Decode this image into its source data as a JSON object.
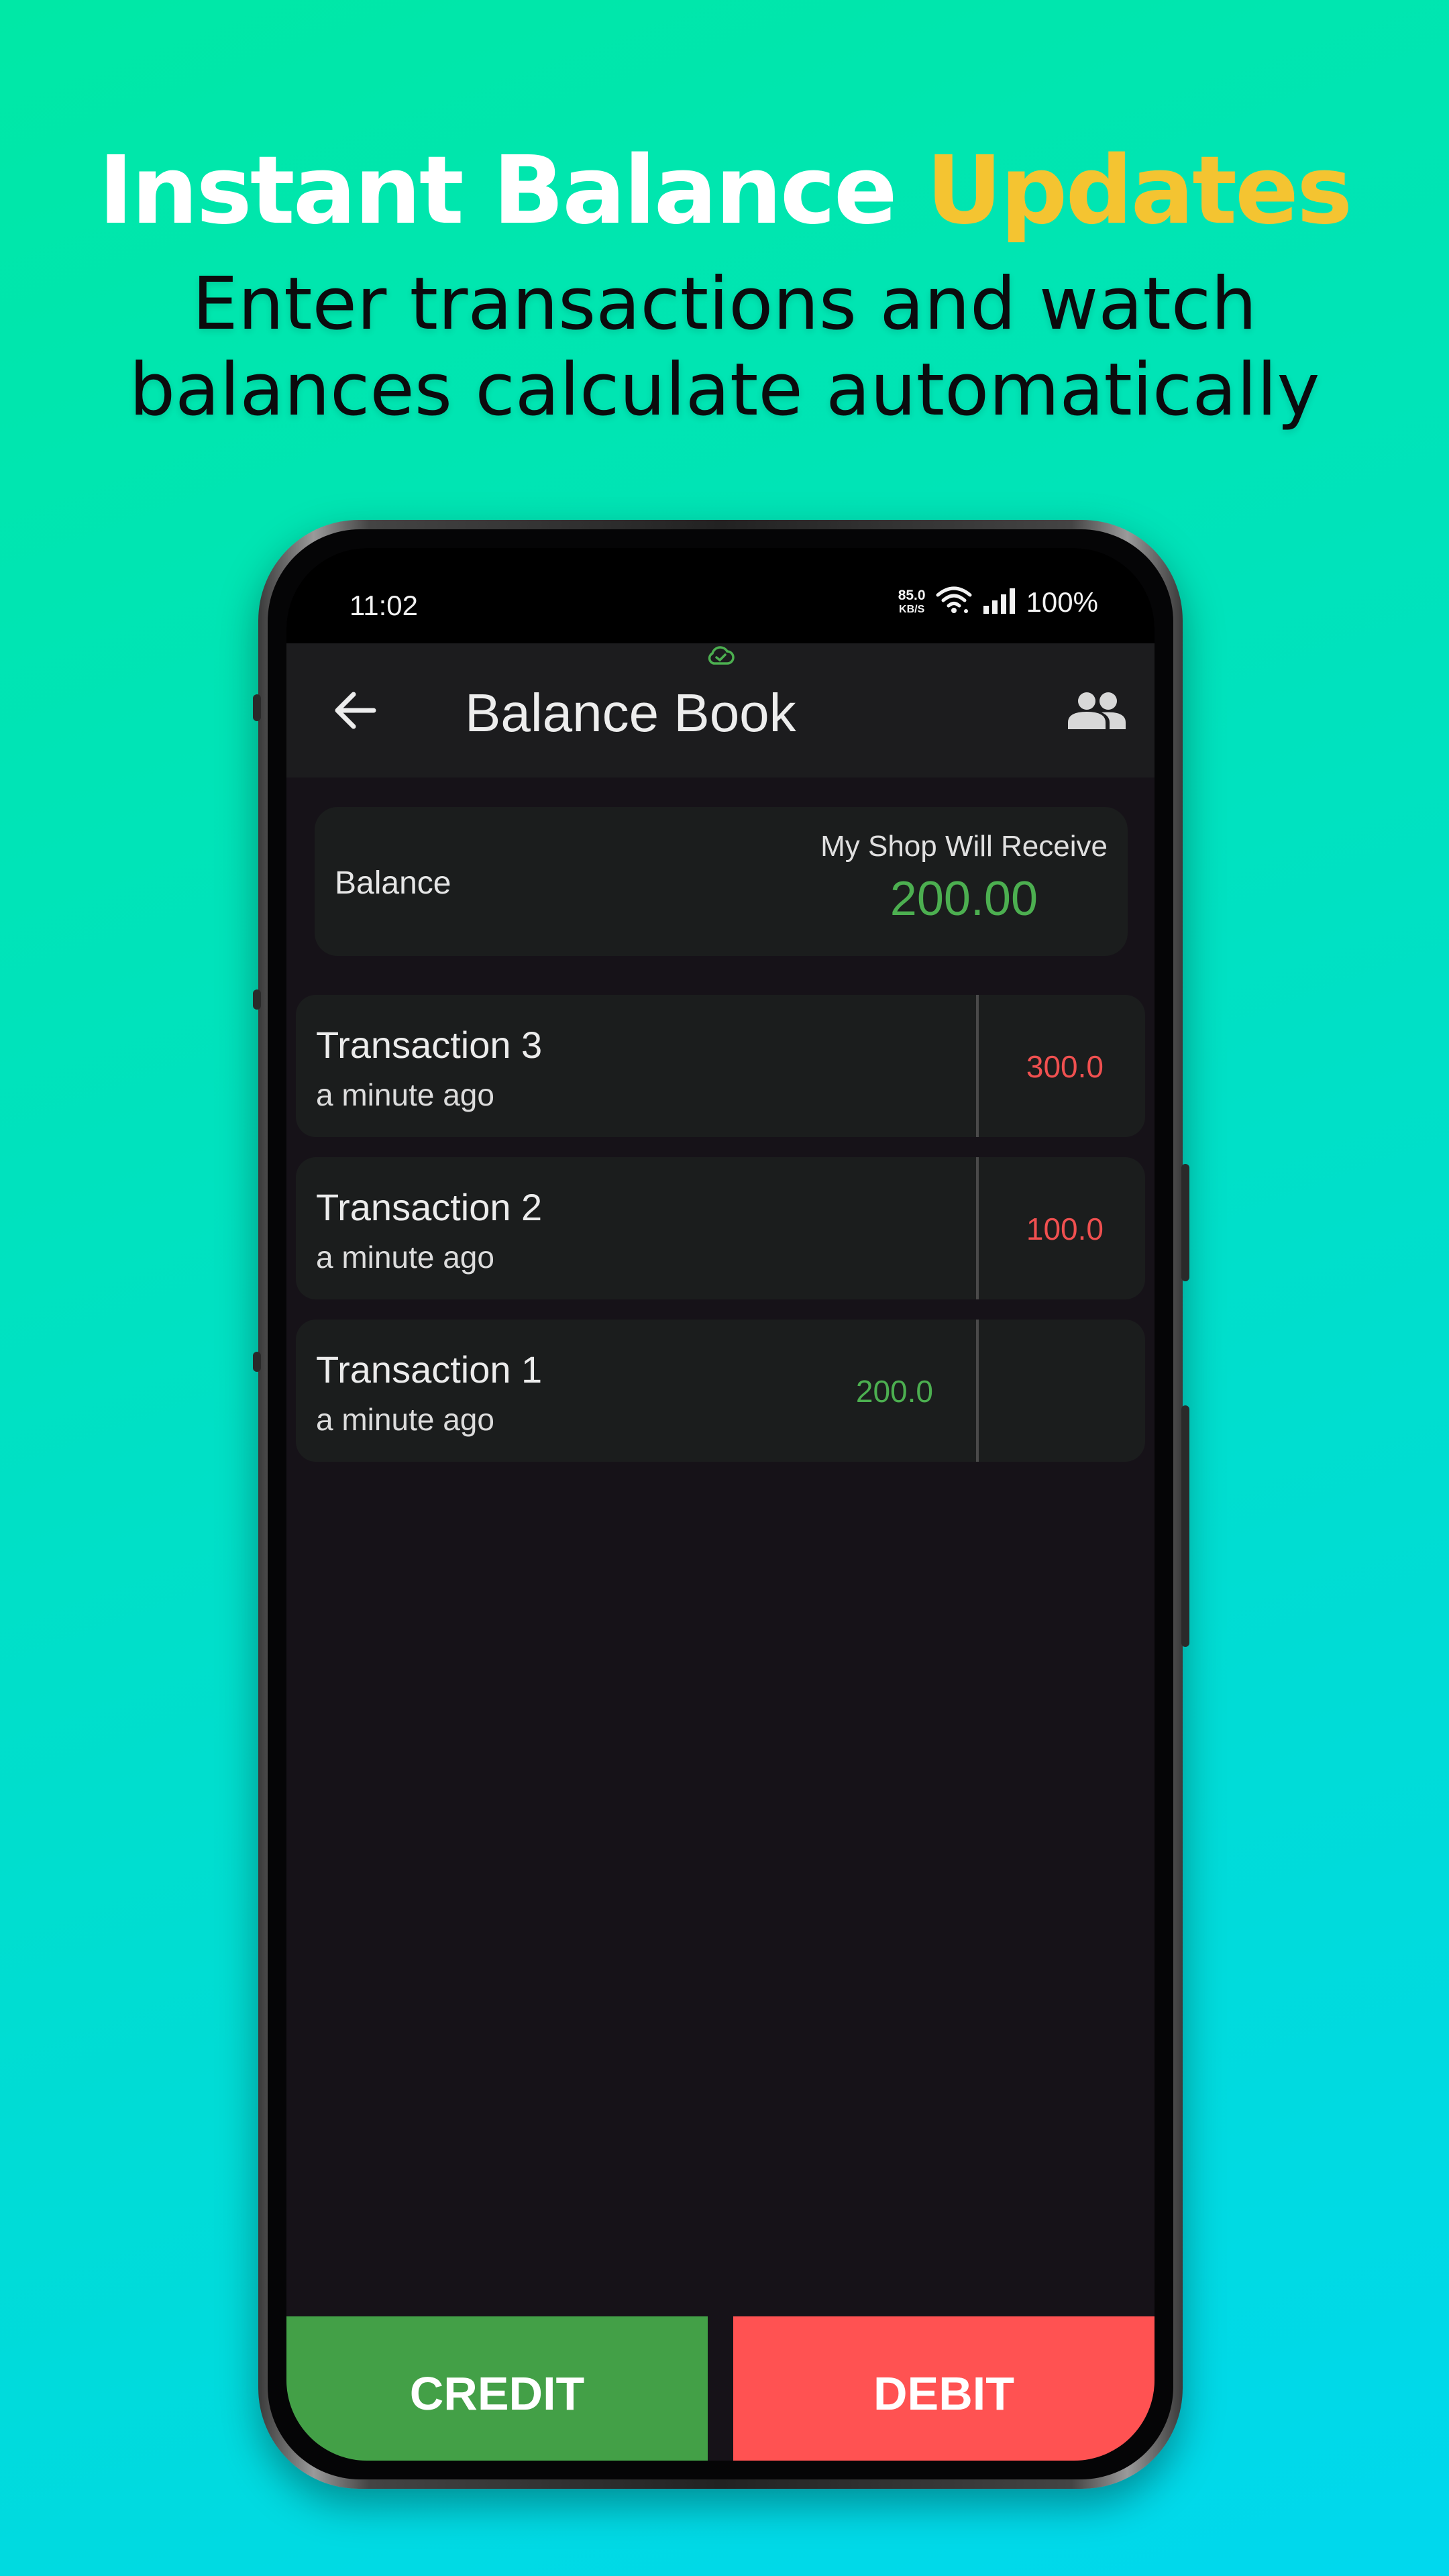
{
  "promo": {
    "title_main": "Instant Balance",
    "title_accent": "Updates",
    "subtitle_line1": "Enter transactions and watch",
    "subtitle_line2": "balances calculate automatically"
  },
  "status_bar": {
    "time": "11:02",
    "net_speed_value": "85.0",
    "net_speed_unit": "KB/S",
    "battery": "100%"
  },
  "app_bar": {
    "title": "Balance Book"
  },
  "balance": {
    "label": "Balance",
    "caption": "My Shop Will Receive",
    "amount": "200.00"
  },
  "transactions": [
    {
      "name": "Transaction 3",
      "time": "a minute ago",
      "credit": "",
      "debit": "300.0"
    },
    {
      "name": "Transaction 2",
      "time": "a minute ago",
      "credit": "",
      "debit": "100.0"
    },
    {
      "name": "Transaction 1",
      "time": "a minute ago",
      "credit": "200.0",
      "debit": ""
    }
  ],
  "actions": {
    "credit_label": "CREDIT",
    "debit_label": "DEBIT"
  },
  "colors": {
    "credit": "#43a047",
    "debit": "#ff5252",
    "accent": "#f4c431"
  },
  "icons": {
    "back": "arrow-left-icon",
    "people": "people-icon",
    "sync": "cloud-sync-icon",
    "wifi": "wifi-icon",
    "signal": "signal-icon"
  }
}
